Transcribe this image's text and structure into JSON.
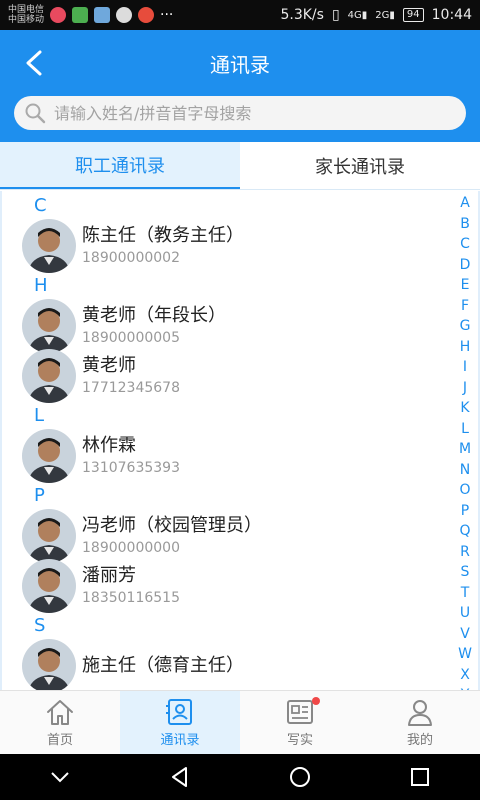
{
  "status_bar": {
    "carrier_1": "中国电信",
    "carrier_2": "中国移动",
    "net_speed": "5.3K/s",
    "battery": "94",
    "time": "10:44"
  },
  "header": {
    "title": "通讯录"
  },
  "search": {
    "placeholder": "请输入姓名/拼音首字母搜索"
  },
  "tabs": [
    {
      "label": "职工通讯录",
      "active": true
    },
    {
      "label": "家长通讯录",
      "active": false
    }
  ],
  "sections": [
    {
      "letter": "C",
      "contacts": [
        {
          "name": "陈主任（教务主任）",
          "phone": "18900000002"
        }
      ]
    },
    {
      "letter": "H",
      "contacts": [
        {
          "name": "黄老师（年段长）",
          "phone": "18900000005"
        },
        {
          "name": "黄老师",
          "phone": "17712345678"
        }
      ]
    },
    {
      "letter": "L",
      "contacts": [
        {
          "name": "林作霖",
          "phone": "13107635393"
        }
      ]
    },
    {
      "letter": "P",
      "contacts": [
        {
          "name": "冯老师（校园管理员）",
          "phone": "18900000000"
        },
        {
          "name": "潘丽芳",
          "phone": "18350116515"
        }
      ]
    },
    {
      "letter": "S",
      "contacts": [
        {
          "name": "施主任（德育主任）",
          "phone": ""
        }
      ]
    }
  ],
  "index_letters": [
    "A",
    "B",
    "C",
    "D",
    "E",
    "F",
    "G",
    "H",
    "I",
    "J",
    "K",
    "L",
    "M",
    "N",
    "O",
    "P",
    "Q",
    "R",
    "S",
    "T",
    "U",
    "V",
    "W",
    "X",
    "Y"
  ],
  "bottom_nav": [
    {
      "label": "首页",
      "icon": "home-icon",
      "active": false
    },
    {
      "label": "通讯录",
      "icon": "contacts-icon",
      "active": true
    },
    {
      "label": "写实",
      "icon": "record-icon",
      "active": false,
      "badge": true
    },
    {
      "label": "我的",
      "icon": "profile-icon",
      "active": false
    }
  ],
  "colors": {
    "primary": "#1e8fee",
    "tab_active_bg": "#e3f2fd",
    "badge": "#f04848"
  }
}
